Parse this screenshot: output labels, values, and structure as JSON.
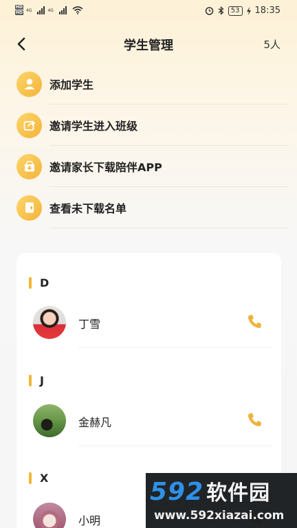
{
  "status_bar": {
    "hd1": "HD",
    "hd2": "HD",
    "net1": "4G",
    "net2": "4G",
    "battery": "53",
    "time": "18:35"
  },
  "header": {
    "title": "学生管理",
    "count": "5人"
  },
  "menu": [
    {
      "label": "添加学生",
      "icon": "user-icon"
    },
    {
      "label": "邀请学生进入班级",
      "icon": "share-icon"
    },
    {
      "label": "邀请家长下载陪伴APP",
      "icon": "download-box-icon"
    },
    {
      "label": "查看未下载名单",
      "icon": "book-icon"
    }
  ],
  "groups": [
    {
      "letter": "D",
      "contacts": [
        {
          "name": "丁雪"
        }
      ]
    },
    {
      "letter": "J",
      "contacts": [
        {
          "name": "金赫凡"
        }
      ]
    },
    {
      "letter": "X",
      "contacts": [
        {
          "name": "小明"
        }
      ]
    }
  ],
  "colors": {
    "accent": "#f2b632",
    "phone": "#eeb33a"
  },
  "watermark": {
    "brand_num": "592",
    "brand_cn": "软件园",
    "url": "www.592xiazai.com"
  }
}
